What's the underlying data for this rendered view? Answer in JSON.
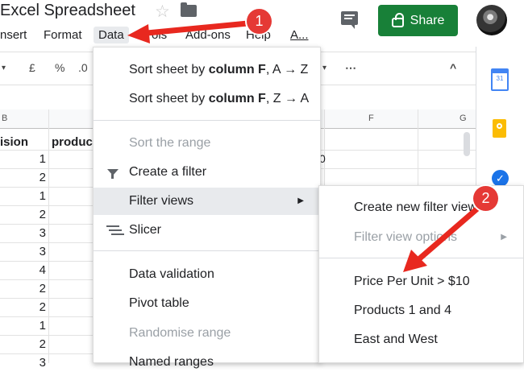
{
  "document": {
    "title": "Excel Spreadsheet"
  },
  "share": {
    "label": "Share"
  },
  "menubar": [
    "nsert",
    "Format",
    "Data",
    "ols",
    "Add-ons",
    "Help",
    "A..."
  ],
  "toolbar": [
    "£",
    "%",
    ".0",
    "⋯",
    "^"
  ],
  "sheet": {
    "columns": {
      "left": "B",
      "right": "F",
      "c": "G"
    },
    "headers": {
      "division": "ision",
      "product": "produc"
    },
    "rows": [
      "1",
      "2",
      "1",
      "2",
      "3",
      "3",
      "4",
      "2",
      "2",
      "1",
      "2",
      "3"
    ],
    "partial_cell": "0"
  },
  "data_menu": {
    "sort_f_az_prefix": "Sort sheet by ",
    "sort_f_az_bold": "column F",
    "sort_f_az_suffix": ", A → Z",
    "sort_f_za_prefix": "Sort sheet by ",
    "sort_f_za_bold": "column F",
    "sort_f_za_suffix": ", Z → A",
    "sort_range": "Sort the range",
    "create_filter": "Create a filter",
    "filter_views": "Filter views",
    "slicer": "Slicer",
    "data_validation": "Data validation",
    "pivot_table": "Pivot table",
    "randomise": "Randomise range",
    "named_ranges": "Named ranges"
  },
  "filter_submenu": {
    "create_new": "Create new filter view",
    "options": "Filter view options",
    "views": [
      "Price Per Unit > $10",
      "Products 1 and 4",
      "East and West"
    ]
  },
  "callouts": [
    "1",
    "2"
  ],
  "colors": {
    "share_green": "#188038",
    "callout_red": "#e53935"
  },
  "side_panel": {
    "calendar_day": "31"
  }
}
